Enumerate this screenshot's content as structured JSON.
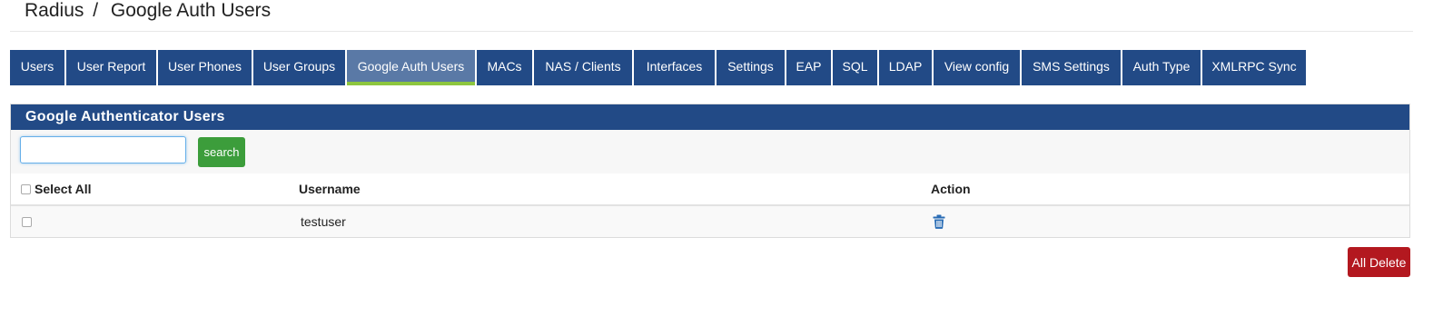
{
  "breadcrumb": {
    "parent": "Radius",
    "separator": "/",
    "current": "Google Auth Users"
  },
  "tabs": [
    {
      "label": "Users",
      "active": false
    },
    {
      "label": "User Report",
      "active": false
    },
    {
      "label": "User Phones",
      "active": false
    },
    {
      "label": "User Groups",
      "active": false
    },
    {
      "label": "Google Auth Users",
      "active": true
    },
    {
      "label": "MACs",
      "active": false
    },
    {
      "label": "NAS / Clients",
      "active": false
    },
    {
      "label": "Interfaces",
      "active": false
    },
    {
      "label": "Settings",
      "active": false
    },
    {
      "label": "EAP",
      "active": false
    },
    {
      "label": "SQL",
      "active": false
    },
    {
      "label": "LDAP",
      "active": false
    },
    {
      "label": "View config",
      "active": false
    },
    {
      "label": "SMS Settings",
      "active": false
    },
    {
      "label": "Auth Type",
      "active": false
    },
    {
      "label": "XMLRPC Sync",
      "active": false
    }
  ],
  "panel": {
    "title": "Google Authenticator Users"
  },
  "search": {
    "value": "",
    "placeholder": "",
    "button_label": "search"
  },
  "table": {
    "columns": {
      "select_all": "Select All",
      "username": "Username",
      "action": "Action"
    },
    "rows": [
      {
        "username": "testuser",
        "action_icon": "trash-icon"
      }
    ]
  },
  "all_delete_label": "All Delete",
  "colors": {
    "nav": "#224a86",
    "active_tab": "#5a79a6",
    "active_underline": "#8dc63f",
    "search_button": "#3c9d3b",
    "delete_button": "#b3181f",
    "trash_icon": "#2a6db5"
  }
}
